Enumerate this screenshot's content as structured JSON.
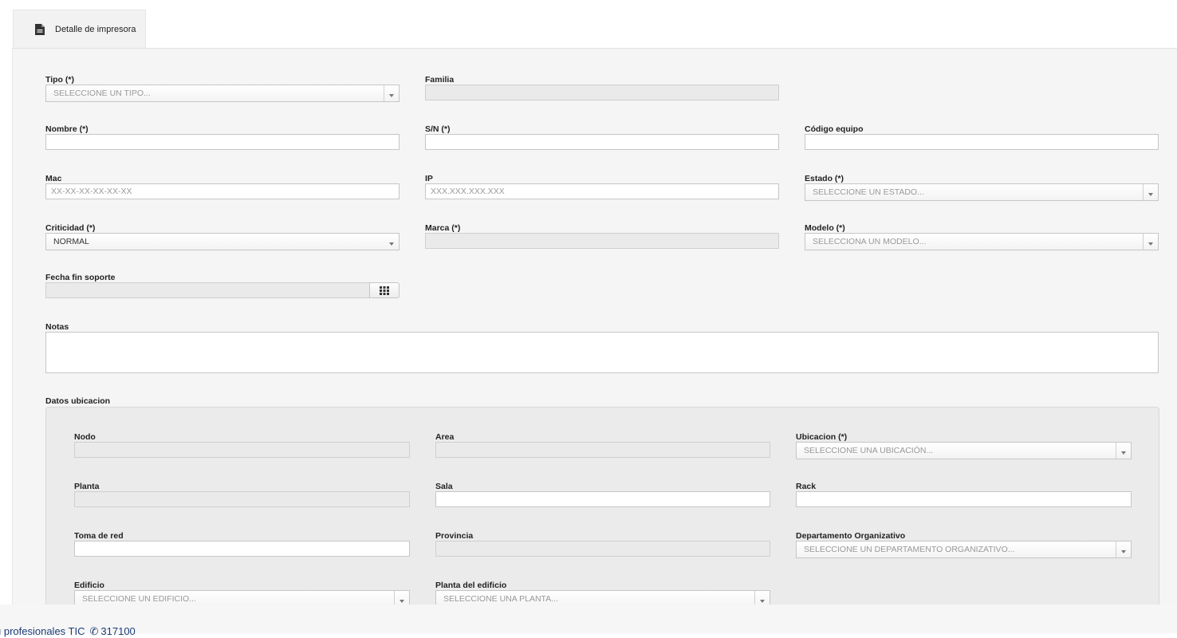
{
  "tab": {
    "label": "Detalle de impresora",
    "icon": "document-icon"
  },
  "form": {
    "tipo": {
      "label": "Tipo (*)",
      "placeholder": "SELECCIONE UN TIPO..."
    },
    "familia": {
      "label": "Familia",
      "value": ""
    },
    "nombre": {
      "label": "Nombre (*)",
      "value": ""
    },
    "sn": {
      "label": "S/N (*)",
      "value": ""
    },
    "codigo_equipo": {
      "label": "Código equipo",
      "value": ""
    },
    "mac": {
      "label": "Mac",
      "placeholder": "XX-XX-XX-XX-XX-XX"
    },
    "ip": {
      "label": "IP",
      "placeholder": "XXX.XXX.XXX.XXX"
    },
    "estado": {
      "label": "Estado (*)",
      "placeholder": "SELECCIONE UN ESTADO..."
    },
    "criticidad": {
      "label": "Criticidad (*)",
      "value": "NORMAL"
    },
    "marca": {
      "label": "Marca (*)",
      "value": ""
    },
    "modelo": {
      "label": "Modelo (*)",
      "placeholder": "SELECCIONA UN MODELO..."
    },
    "fecha_fin_soporte": {
      "label": "Fecha fin soporte",
      "value": "",
      "icon": "calendar-grid-icon"
    },
    "notas": {
      "label": "Notas",
      "value": ""
    }
  },
  "ubicacion": {
    "section_label": "Datos ubicacion",
    "nodo": {
      "label": "Nodo",
      "value": ""
    },
    "area": {
      "label": "Area",
      "value": ""
    },
    "ubicacion": {
      "label": "Ubicacion (*)",
      "placeholder": "SELECCIONE UNA UBICACIÓN..."
    },
    "planta": {
      "label": "Planta",
      "value": ""
    },
    "sala": {
      "label": "Sala",
      "value": ""
    },
    "rack": {
      "label": "Rack",
      "value": ""
    },
    "toma_de_red": {
      "label": "Toma de red",
      "value": ""
    },
    "provincia": {
      "label": "Provincia",
      "value": ""
    },
    "departamento": {
      "label": "Departamento Organizativo",
      "placeholder": "SELECCIONE UN DEPARTAMENTO ORGANIZATIVO..."
    },
    "edificio": {
      "label": "Edificio",
      "placeholder": "SELECCIONE UN EDIFICIO..."
    },
    "planta_edificio": {
      "label": "Planta del edificio",
      "placeholder": "SELECCIONE UNA PLANTA..."
    }
  },
  "footer": {
    "text": "u profesionales TIC",
    "phone": "317100",
    "phone_icon": "phone-icon"
  },
  "colors": {
    "panel_bg": "#f5f5f5",
    "location_bg": "#ebebeb",
    "footer_link": "#1d3c78"
  }
}
